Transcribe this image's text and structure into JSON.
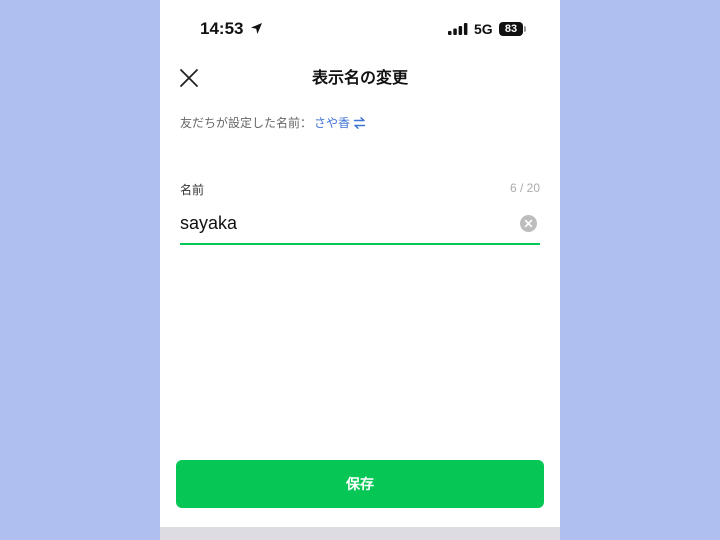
{
  "status_bar": {
    "time": "14:53",
    "network": "5G",
    "battery": "83"
  },
  "header": {
    "title": "表示名の変更"
  },
  "friend_set_name": {
    "label": "友だちが設定した名前：",
    "value": "さや香"
  },
  "name_field": {
    "label": "名前",
    "value": "sayaka",
    "count": "6 / 20"
  },
  "save_button": {
    "label": "保存"
  },
  "colors": {
    "accent": "#06c755",
    "link": "#3f74d6",
    "background": "#aebff0"
  }
}
